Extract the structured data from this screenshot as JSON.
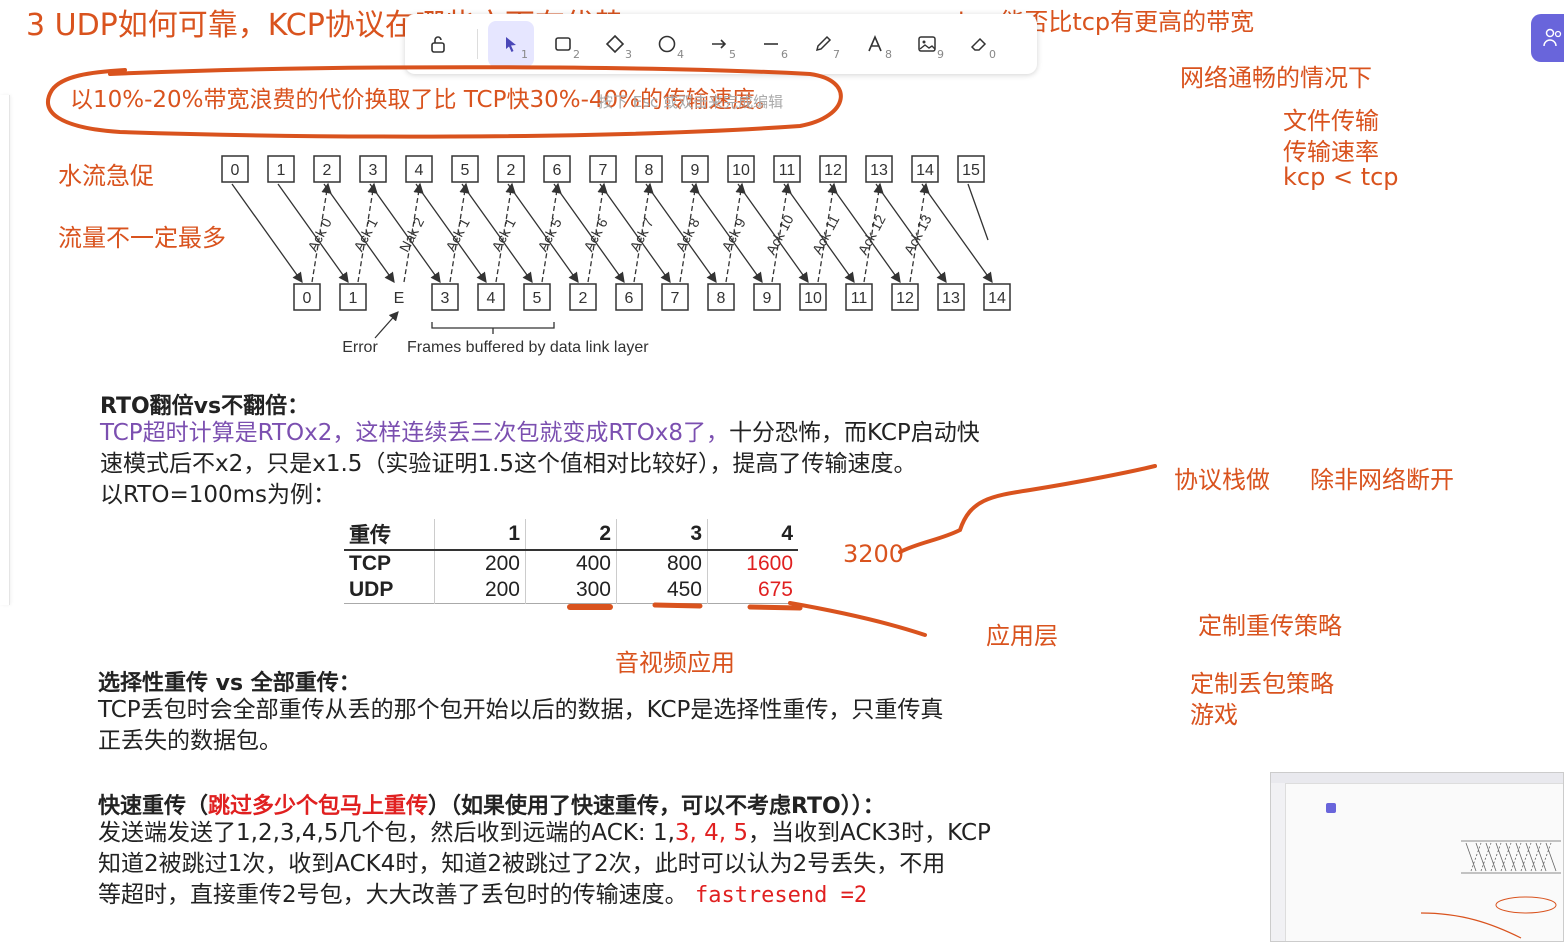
{
  "toolbar": {
    "tools": [
      {
        "icon": "lock-icon",
        "key": ""
      },
      {
        "icon": "pointer-icon",
        "key": "1"
      },
      {
        "icon": "rectangle-icon",
        "key": "2"
      },
      {
        "icon": "diamond-icon",
        "key": "3"
      },
      {
        "icon": "ellipse-icon",
        "key": "4"
      },
      {
        "icon": "arrow-icon",
        "key": "5"
      },
      {
        "icon": "line-icon",
        "key": "6"
      },
      {
        "icon": "pencil-icon",
        "key": "7"
      },
      {
        "icon": "text-icon",
        "key": "8"
      },
      {
        "icon": "image-icon",
        "key": "9"
      },
      {
        "icon": "eraser-icon",
        "key": "0"
      }
    ],
    "hint": "按下 Esc 或双击来完成编辑"
  },
  "canvas": {
    "title": "3 UDP如何可靠，KCP协议在哪些方面有优势",
    "top_note": "kcp能否比tcp有更高的带宽",
    "highlight": "以10%-20%带宽浪费的代价换取了比 TCP快30%-40%的传输速度。",
    "left_notes": [
      "水流急促",
      "流量不一定最多"
    ],
    "right_notes": [
      "网络通畅的情况下",
      "文件传输",
      "传输速率",
      "kcp < tcp"
    ],
    "mid_notes": {
      "stack": "协议栈做",
      "unless": "除非网络断开",
      "value": "3200",
      "app": "应用层",
      "av": "音视频应用",
      "retrans": "定制重传策略",
      "drop": "定制丢包策略",
      "game": "游戏"
    },
    "diagram": {
      "top_frames": [
        "0",
        "1",
        "2",
        "3",
        "4",
        "5",
        "2",
        "6",
        "7",
        "8",
        "9",
        "10",
        "11",
        "12",
        "13",
        "14",
        "15"
      ],
      "bottom_frames": [
        "0",
        "1",
        "E",
        "3",
        "4",
        "5",
        "2",
        "6",
        "7",
        "8",
        "9",
        "10",
        "11",
        "12",
        "13",
        "14"
      ],
      "acks": [
        "Ack 0",
        "Ack 1",
        "Nak 2",
        "Ack 1",
        "Ack 1",
        "Ack 5",
        "Ack 6",
        "Ack 7",
        "Ack 8",
        "Ack 9",
        "Ack 10",
        "Ack 11",
        "Ack 12",
        "Ack 13"
      ],
      "error_label": "Error",
      "buffer_label": "Frames buffered by data link layer"
    },
    "rto": {
      "heading": "RTO翻倍vs不翻倍：",
      "line1_purple": "TCP超时计算是RTOx2，这样连续丢三次包就变成RTOx8了，",
      "line1_rest": "十分恐怖，而KCP启动快",
      "line2": "速模式后不x2，只是x1.5（实验证明1.5这个值相对比较好），提高了传输速度。",
      "line3": "以RTO=100ms为例：",
      "table": {
        "header": [
          "重传",
          "1",
          "2",
          "3",
          "4"
        ],
        "rows": [
          {
            "label": "TCP",
            "values": [
              "200",
              "400",
              "800",
              "1600"
            ]
          },
          {
            "label": "UDP",
            "values": [
              "200",
              "300",
              "450",
              "675"
            ]
          }
        ]
      }
    },
    "selective": {
      "heading": "选择性重传 vs 全部重传：",
      "line1": "TCP丢包时会全部重传从丢的那个包开始以后的数据，KCP是选择性重传，只重传真",
      "line2": "正丢失的数据包。"
    },
    "fast": {
      "heading_a": "快速重传（",
      "heading_red": "跳过多少个包马上重传",
      "heading_b": "）（如果使用了快速重传，可以不考虑RTO））：",
      "line1_a": "发送端发送了1,2,3,4,5几个包，然后收到远端的ACK: 1,",
      "line1_red": "3, 4, 5",
      "line1_b": "，当收到ACK3时，KCP",
      "line2": "知道2被跳过1次，收到ACK4时，知道2被跳过了2次，此时可以认为2号丢失，不用",
      "line3": "等超时，直接重传2号包，大大改善了丢包时的传输速度。",
      "code": "fastresend =2"
    }
  },
  "colors": {
    "accent": "#d9531e",
    "purple": "#7b4fb0",
    "red": "#e02020",
    "toolbar_active": "#e6e6ff",
    "collab": "#6965db"
  }
}
